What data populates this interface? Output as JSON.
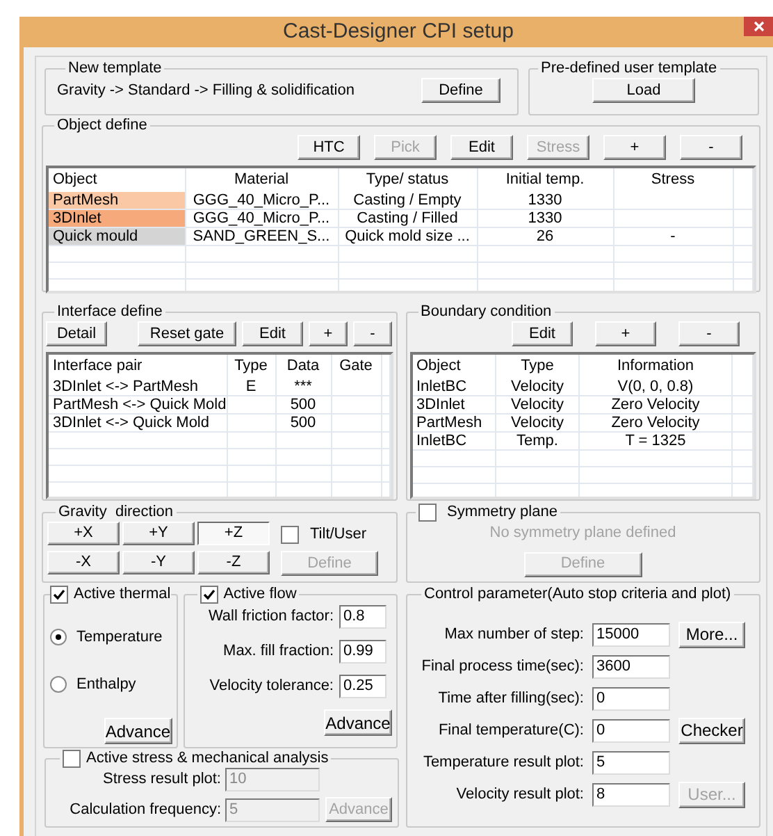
{
  "window": {
    "title": "Cast-Designer CPI setup"
  },
  "new_template": {
    "legend": "New template",
    "path": "Gravity -> Standard -> Filling & solidification",
    "button": {
      "label": "Define",
      "disabled": false
    }
  },
  "predefined_template": {
    "legend": "Pre-defined user template",
    "button": {
      "label": "Load",
      "disabled": false
    }
  },
  "object_define": {
    "legend": "Object define",
    "buttons": [
      {
        "label": "HTC",
        "disabled": false
      },
      {
        "label": "Pick",
        "disabled": true
      },
      {
        "label": "Edit",
        "disabled": false
      },
      {
        "label": "Stress",
        "disabled": true
      },
      {
        "label": "+",
        "disabled": false
      },
      {
        "label": "-",
        "disabled": false
      }
    ],
    "table": {
      "columns": [
        "Object",
        "Material",
        "Type/ status",
        "Initial temp.",
        "Stress"
      ],
      "rows": [
        {
          "object": "PartMesh",
          "color": "#fbc8a6",
          "material": "GGG_40_Micro_P...",
          "type_status": "Casting / Empty",
          "initial_temp": "1330"
        },
        {
          "object": "3DInlet",
          "color": "#f6a97a",
          "material": "GGG_40_Micro_P...",
          "type_status": "Casting / Filled",
          "initial_temp": "1330"
        },
        {
          "object": "Quick mould",
          "color": "#d4d4d4",
          "material": "SAND_GREEN_S...",
          "type_status": "Quick mold size ...",
          "initial_temp": "26",
          "stress": "-"
        }
      ]
    }
  },
  "interface_define": {
    "legend": "Interface define",
    "buttons": [
      {
        "label": "Detail",
        "disabled": false
      },
      {
        "label": "Reset gate",
        "disabled": false
      },
      {
        "label": "Edit",
        "disabled": false
      },
      {
        "label": "+",
        "disabled": false
      },
      {
        "label": "-",
        "disabled": false
      }
    ],
    "table": {
      "columns": [
        "Interface pair",
        "Type",
        "Data",
        "Gate"
      ],
      "rows": [
        {
          "pair": "3DInlet <-> PartMesh",
          "type": "E",
          "data": "***"
        },
        {
          "pair": "PartMesh <-> Quick Mold",
          "data": "500"
        },
        {
          "pair": "3DInlet <-> Quick Mold",
          "data": "500"
        }
      ]
    }
  },
  "boundary_condition": {
    "legend": "Boundary condition",
    "buttons": [
      {
        "label": "Edit",
        "disabled": false
      },
      {
        "label": "+",
        "disabled": false
      },
      {
        "label": "-",
        "disabled": false
      }
    ],
    "table": {
      "columns": [
        "Object",
        "Type",
        "Information"
      ],
      "rows": [
        {
          "object": "InletBC",
          "type": "Velocity",
          "information": "V(0, 0, 0.8)"
        },
        {
          "object": "3DInlet",
          "type": "Velocity",
          "information": "Zero Velocity"
        },
        {
          "object": "PartMesh",
          "type": "Velocity",
          "information": "Zero Velocity"
        },
        {
          "object": "InletBC",
          "type": "Temp.",
          "information": "T = 1325"
        }
      ]
    }
  },
  "gravity_direction": {
    "legend": "Gravity  direction",
    "buttons": [
      {
        "label": "+X",
        "selected": false
      },
      {
        "label": "+Y",
        "selected": false
      },
      {
        "label": "+Z",
        "selected": true
      },
      {
        "label": "-X",
        "selected": false
      },
      {
        "label": "-Y",
        "selected": false
      },
      {
        "label": "-Z",
        "selected": false
      }
    ],
    "tilt": {
      "label": "Tilt/User",
      "checked": false
    },
    "define": {
      "label": "Define",
      "disabled": true
    }
  },
  "symmetry_plane": {
    "label": "Symmetry plane",
    "checked": false,
    "message": "No symmetry plane defined",
    "define": {
      "label": "Define",
      "disabled": true
    }
  },
  "active_thermal": {
    "label": "Active thermal",
    "checked": true,
    "options": [
      {
        "label": "Temperature",
        "selected": true
      },
      {
        "label": "Enthalpy",
        "selected": false
      }
    ],
    "button": {
      "label": "Advance",
      "disabled": false
    }
  },
  "active_flow": {
    "label": "Active flow",
    "checked": true,
    "fields": [
      {
        "label": "Wall friction factor:",
        "value": "0.8",
        "disabled": false
      },
      {
        "label": "Max. fill fraction:",
        "value": "0.99",
        "disabled": false
      },
      {
        "label": "Velocity tolerance:",
        "value": "0.25",
        "disabled": false
      }
    ],
    "button": {
      "label": "Advance",
      "disabled": false
    }
  },
  "active_stress": {
    "label": "Active stress & mechanical analysis",
    "checked": false,
    "fields": [
      {
        "label": "Stress result plot:",
        "value": "10",
        "disabled": true
      },
      {
        "label": "Calculation frequency:",
        "value": "5",
        "disabled": true
      }
    ],
    "button": {
      "label": "Advance",
      "disabled": true
    }
  },
  "control_parameter": {
    "legend": "Control parameter(Auto stop criteria and plot)",
    "fields": [
      {
        "label": "Max number of step:",
        "value": "15000",
        "button": {
          "label": "More...",
          "disabled": false
        }
      },
      {
        "label": "Final process time(sec):",
        "value": "3600"
      },
      {
        "label": "Time after filling(sec):",
        "value": "0"
      },
      {
        "label": "Final temperature(C):",
        "value": "0",
        "button": {
          "label": "Checker",
          "disabled": false
        }
      },
      {
        "label": "Temperature result plot:",
        "value": "5"
      },
      {
        "label": "Velocity result plot:",
        "value": "8",
        "button": {
          "label": "User...",
          "disabled": true
        }
      }
    ]
  }
}
